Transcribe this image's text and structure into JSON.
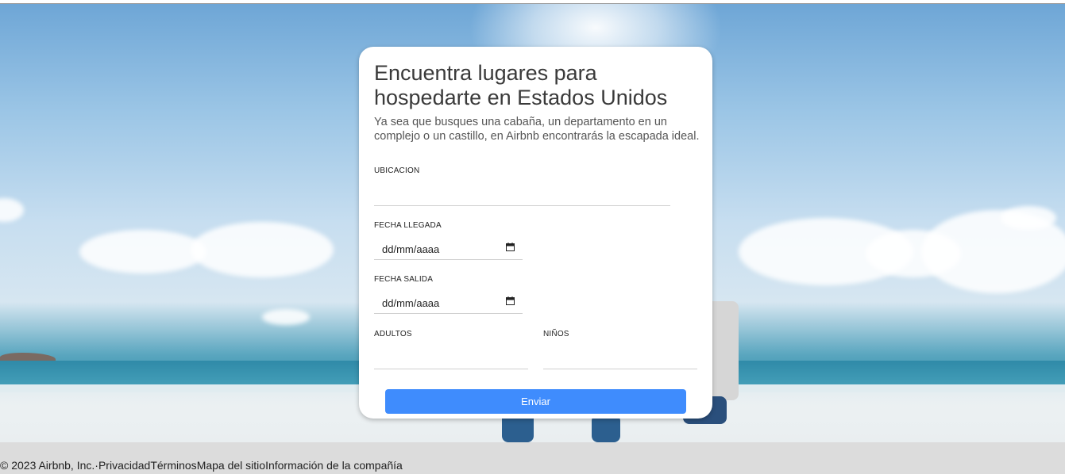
{
  "card": {
    "title": "Encuentra lugares para hospedarte en Estados Unidos",
    "subtitle": "Ya sea que busques una cabaña, un departamento en un complejo o un castillo, en Airbnb encontrarás la escapada ideal."
  },
  "form": {
    "location_label": "UBICACION",
    "location_value": "",
    "arrival_label": "FECHA LLEGADA",
    "arrival_value": "dd/mm/aaaa",
    "departure_label": "FECHA SALIDA",
    "departure_value": "dd/mm/aaaa",
    "adults_label": "ADULTOS",
    "adults_value": "",
    "children_label": "NIÑOS",
    "children_value": "",
    "submit_label": "Enviar"
  },
  "footer": {
    "copyright": "© 2023 Airbnb, Inc.",
    "separator": "·",
    "links": [
      "Privacidad",
      "Términos",
      "Mapa del sitio",
      "Información de la compañía"
    ]
  },
  "icons": {
    "calendar": "calendar-icon"
  },
  "colors": {
    "button": "#3f8cfd",
    "card": "#ffffff",
    "footer_bg": "#dcdcdc"
  }
}
